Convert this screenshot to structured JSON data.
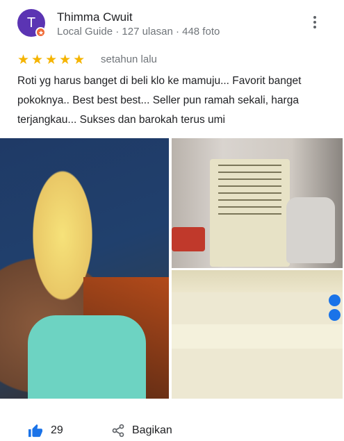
{
  "reviewer": {
    "initial": "T",
    "name": "Thimma Cwuit",
    "meta": "Local Guide · 127 ulasan · 448 foto"
  },
  "review": {
    "stars": "★★★★★",
    "rating": 5,
    "date": "setahun lalu",
    "text": "Roti yg harus banget di beli klo ke mamuju... Favorit banget pokoknya.. Best best best... Seller pun ramah sekali, harga terjangkau... Sukses dan barokah terus umi"
  },
  "actions": {
    "like_count": "29",
    "share_label": "Bagikan"
  },
  "colors": {
    "avatar": "#5b34b3",
    "badge": "#f06a36",
    "star": "#f5b400",
    "like": "#1a73e8"
  }
}
